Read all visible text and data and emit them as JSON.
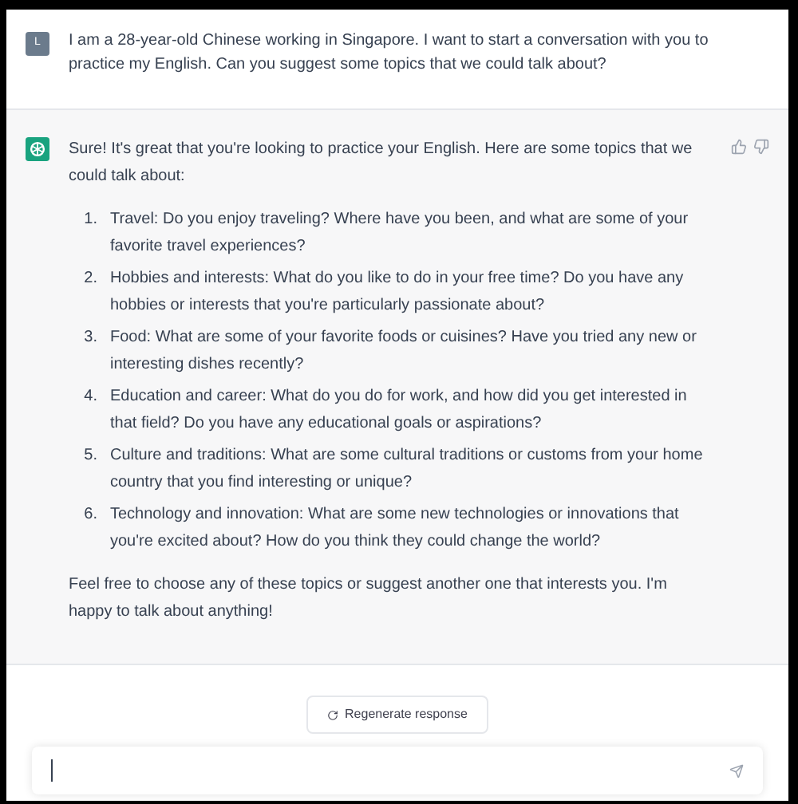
{
  "user_message": {
    "avatar": "L",
    "text": "I am a 28-year-old Chinese working in Singapore. I want to start a conversation with you to practice my English. Can you suggest some topics that we could talk about?"
  },
  "assistant_message": {
    "intro": "Sure! It's great that you're looking to practice your English. Here are some topics that we could talk about:",
    "topics": [
      {
        "number": "1.",
        "text": "Travel: Do you enjoy traveling? Where have you been, and what are some of your favorite travel experiences?"
      },
      {
        "number": "2.",
        "text": "Hobbies and interests: What do you like to do in your free time? Do you have any hobbies or interests that you're particularly passionate about?"
      },
      {
        "number": "3.",
        "text": "Food: What are some of your favorite foods or cuisines? Have you tried any new or interesting dishes recently?"
      },
      {
        "number": "4.",
        "text": "Education and career: What do you do for work, and how did you get interested in that field? Do you have any educational goals or aspirations?"
      },
      {
        "number": "5.",
        "text": "Culture and traditions: What are some cultural traditions or customs from your home country that you find interesting or unique?"
      },
      {
        "number": "6.",
        "text": "Technology and innovation: What are some new technologies or innovations that you're excited about? How do you think they could change the world?"
      }
    ],
    "outro": "Feel free to choose any of these topics or suggest another one that interests you. I'm happy to talk about anything!"
  },
  "regenerate_button": "Regenerate response"
}
